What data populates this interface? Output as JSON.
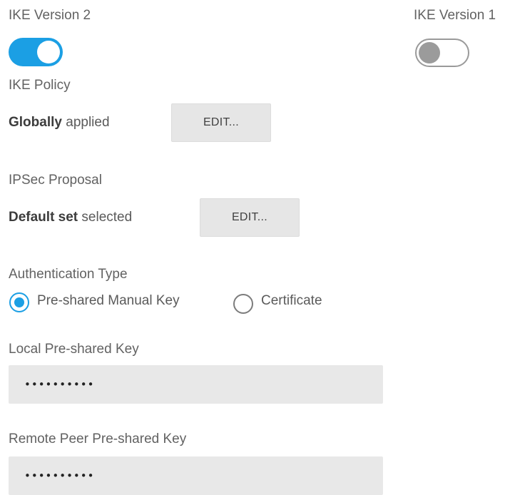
{
  "ike_v2": {
    "label": "IKE Version 2",
    "enabled": true
  },
  "ike_v1": {
    "label": "IKE Version 1",
    "enabled": false
  },
  "ike_policy": {
    "label": "IKE Policy",
    "status_bold": "Globally",
    "status_rest": " applied",
    "edit_label": "EDIT..."
  },
  "ipsec_proposal": {
    "label": "IPSec Proposal",
    "status_bold": "Default set",
    "status_rest": " selected",
    "edit_label": "EDIT..."
  },
  "auth_type": {
    "label": "Authentication Type",
    "options": [
      {
        "label": "Pre-shared Manual Key",
        "selected": true
      },
      {
        "label": "Certificate",
        "selected": false
      }
    ]
  },
  "local_key": {
    "label": "Local Pre-shared Key",
    "value": "••••••••••"
  },
  "remote_key": {
    "label": "Remote Peer Pre-shared Key",
    "value": "••••••••••"
  },
  "colors": {
    "accent": "#1b9fe4",
    "toggle_off": "#9b9b9b",
    "button_bg": "#e6e6e6",
    "input_bg": "#e8e8e8"
  }
}
